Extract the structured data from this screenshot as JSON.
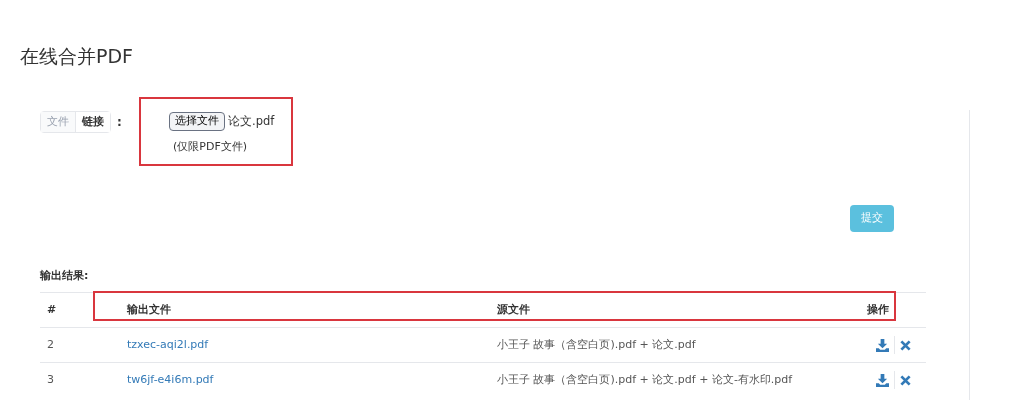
{
  "title": "在线合并PDF",
  "source_tabs": [
    {
      "label": "文件",
      "selected": true
    },
    {
      "label": "链接",
      "selected": false
    }
  ],
  "colon": ":",
  "file_input": {
    "button": "选择文件",
    "value": "论文.pdf",
    "hint": "(仅限PDF文件)"
  },
  "submit_button": "提交",
  "results": {
    "heading": "输出结果:",
    "columns": [
      "#",
      "输出文件",
      "源文件",
      "操作"
    ],
    "rows": [
      {
        "index": "2",
        "output_file": "tzxec-aqi2l.pdf",
        "source_files": "小王子 故事（含空白页).pdf + 论文.pdf"
      },
      {
        "index": "3",
        "output_file": "tw6jf-e4i6m.pdf",
        "source_files": "小王子 故事（含空白页).pdf + 论文.pdf + 论文-有水印.pdf"
      }
    ]
  }
}
